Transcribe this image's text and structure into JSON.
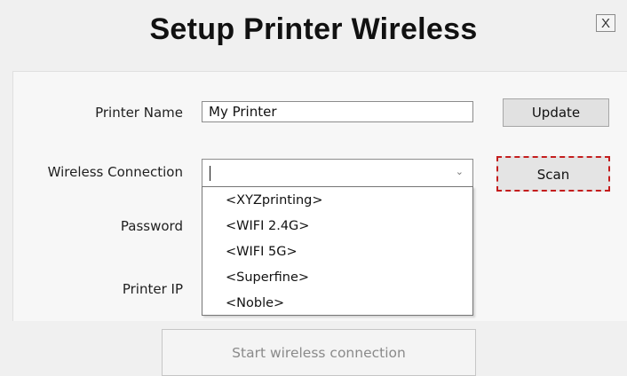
{
  "window": {
    "title": "Setup Printer Wireless",
    "close_label": "X"
  },
  "form": {
    "printer_name_label": "Printer Name",
    "printer_name_value": "My Printer",
    "wireless_label": "Wireless Connection",
    "wireless_value": "",
    "password_label": "Password",
    "printer_ip_label": "Printer IP"
  },
  "buttons": {
    "update": "Update",
    "scan": "Scan",
    "start": "Start wireless connection"
  },
  "dropdown": {
    "options": [
      "<XYZprinting>",
      "<WIFI 2.4G>",
      "<WIFI 5G>",
      "<Superfine>",
      "<Noble>"
    ]
  },
  "icons": {
    "chevron": "chevron-down-icon",
    "close": "close-icon"
  },
  "colors": {
    "scan_highlight": "#c41d1d"
  }
}
